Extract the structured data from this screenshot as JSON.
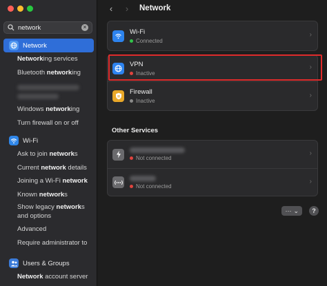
{
  "search": {
    "value": "network",
    "clear_glyph": "×"
  },
  "sidebar": {
    "network": {
      "label": "Network",
      "icon": "globe-icon",
      "items": [
        {
          "pre": "",
          "bold": "Network",
          "post": "ing services"
        },
        {
          "pre": "Bluetooth ",
          "bold": "network",
          "post": "ing"
        }
      ],
      "items2": [
        {
          "pre": "Windows ",
          "bold": "network",
          "post": "ing"
        },
        {
          "pre": "Turn firewall on or off",
          "bold": "",
          "post": ""
        }
      ]
    },
    "wifi": {
      "label": "Wi-Fi",
      "icon": "wifi-icon",
      "items": [
        {
          "pre": "Ask to join ",
          "bold": "network",
          "post": "s"
        },
        {
          "pre": "Current ",
          "bold": "network",
          "post": " details"
        },
        {
          "pre": "Joining a Wi-Fi ",
          "bold": "network",
          "post": ""
        },
        {
          "pre": "Known ",
          "bold": "network",
          "post": "s"
        },
        {
          "pre": "Show legacy ",
          "bold": "network",
          "post": "s",
          "line2": "and options"
        },
        {
          "pre": "Advanced",
          "bold": "",
          "post": ""
        },
        {
          "pre": "Require administrator to",
          "bold": "",
          "post": ""
        }
      ]
    },
    "users": {
      "label": "Users & Groups",
      "icon": "users-icon",
      "items": [
        {
          "pre": "",
          "bold": "Network",
          "post": " account server"
        }
      ]
    }
  },
  "header": {
    "title": "Network",
    "back": "‹",
    "forward": "›"
  },
  "services": [
    {
      "name": "Wi-Fi",
      "status": "Connected",
      "status_color": "#32c34a",
      "icon": "wifi-icon",
      "icon_color": "blue"
    },
    {
      "name": "VPN",
      "status": "Inactive",
      "status_color": "#e0443e",
      "icon": "vpn-globe-icon",
      "icon_color": "blue"
    },
    {
      "name": "Firewall",
      "status": "Inactive",
      "status_color": "#8a8a8a",
      "icon": "firewall-shield-icon",
      "icon_color": "yellow"
    }
  ],
  "other_services": {
    "title": "Other Services",
    "items": [
      {
        "status": "Not connected",
        "status_color": "#e0443e",
        "icon": "thunderbolt-icon"
      },
      {
        "status": "Not connected",
        "status_color": "#e0443e",
        "icon": "ethernet-icon"
      }
    ]
  },
  "controls": {
    "more": "···",
    "more_caret": "⌄",
    "help": "?"
  }
}
